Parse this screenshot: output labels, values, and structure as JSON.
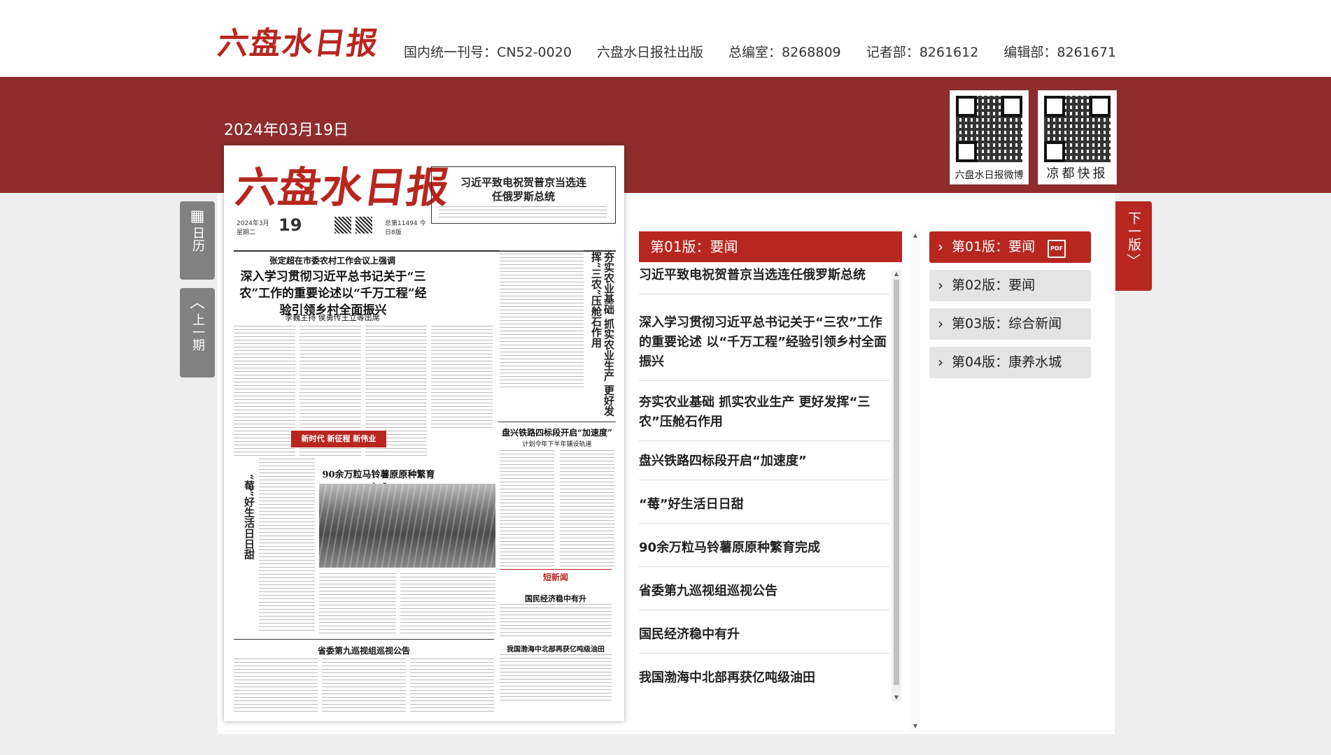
{
  "header": {
    "logo_text": "六盘水日报",
    "info": [
      "国内统一刊号：CN52-0020",
      "六盘水日报社出版",
      "总编室：8268809",
      "记者部：8261612",
      "编辑部：8261671"
    ]
  },
  "date": "2024年03月19日",
  "qr_codes": [
    {
      "caption": "六盘水日报微博"
    },
    {
      "caption": "凉都快报"
    }
  ],
  "side_buttons": {
    "calendar_label": "日历",
    "prev_label": "上一期",
    "next_label": "下一版"
  },
  "newspaper": {
    "logo": "六盘水日报",
    "top_headline": "习近平致电祝贺普京当选连任俄罗斯总统",
    "mast_day": "19",
    "mast_date": "2024年3月 星期二",
    "mast_issue": "总第11494 今日8版",
    "kicker": "张定超在市委农村工作会议上强调",
    "lead_headline": "深入学习贯彻习近平总书记关于“三农”工作的重要论述以“千万工程”经验引领乡村全面振兴",
    "lead_byline": "李巍主持  侯勇传王立等出席",
    "right_vertical": "夯实农业基础 抓实农业生产 更好发挥“三农”压舱石作用",
    "railway_headline": "盘兴铁路四标段开启“加速度”",
    "railway_sub": "计划今年下半年铺设轨道",
    "banner_text": "新时代 新征程 新伟业",
    "potato_headline": "90余万粒马铃薯原原种繁育完成",
    "berry_vertical": "“莓”好生活日日甜",
    "news_title": "短新闻",
    "econ_headline": "国民经济稳中有升",
    "oil_headline": "我国渤海中北部再获亿吨级油田",
    "notice_headline": "省委第九巡视组巡视公告"
  },
  "current_page": {
    "label": "第01版：要闻"
  },
  "articles": [
    "习近平致电祝贺普京当选连任俄罗斯总统",
    "深入学习贯彻习近平总书记关于“三农”工作的重要论述 以“千万工程”经验引领乡村全面振兴",
    "夯实农业基础 抓实农业生产 更好发挥“三农”压舱石作用",
    "盘兴铁路四标段开启“加速度”",
    "“莓”好生活日日甜",
    "90余万粒马铃薯原原种繁育完成",
    "省委第九巡视组巡视公告",
    "国民经济稳中有升",
    "我国渤海中北部再获亿吨级油田"
  ],
  "pages": [
    {
      "label": "第01版：要闻",
      "active": true,
      "pdf": "PDF"
    },
    {
      "label": "第02版：要闻"
    },
    {
      "label": "第03版：综合新闻"
    },
    {
      "label": "第04版：康养水城"
    }
  ]
}
